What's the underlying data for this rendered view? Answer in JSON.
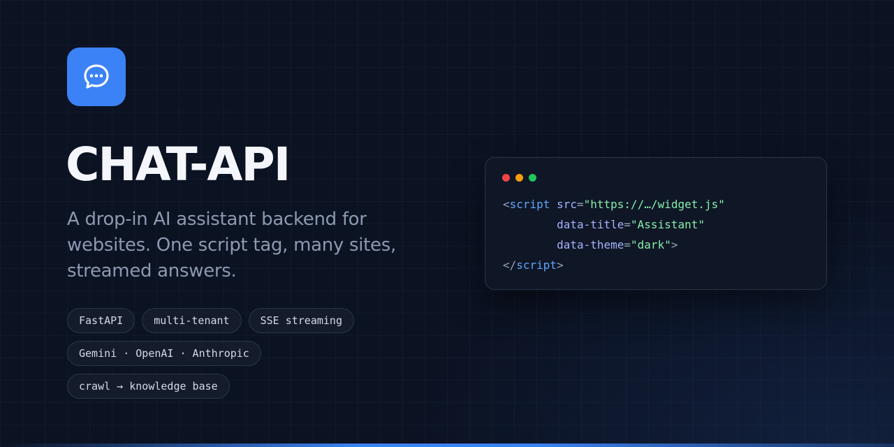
{
  "brand": {
    "icon": "chat-bubble-icon",
    "accent_color": "#3b82f6",
    "title": "CHAT-API",
    "subtitle": "A drop-in AI assistant backend for websites. One script tag, many sites, streamed answers."
  },
  "tags": {
    "row1": [
      "FastAPI",
      "multi-tenant",
      "SSE streaming"
    ],
    "row2": [
      "Gemini · OpenAI · Anthropic"
    ],
    "row3": [
      "crawl → knowledge base"
    ]
  },
  "code_window": {
    "dot_colors": [
      "#ef4444",
      "#f59e0b",
      "#22c55e"
    ],
    "open_bracket": "<",
    "tag_name": "script",
    "attr_src": "src",
    "val_src": "\"https://…/widget.js\"",
    "attr_title": "data-title",
    "val_title": "\"Assistant\"",
    "attr_theme": "data-theme",
    "val_theme": "\"dark\"",
    "close_bracket": ">",
    "close_open": "</",
    "close_tag_name": "script",
    "close_end": ">",
    "equals": "="
  }
}
